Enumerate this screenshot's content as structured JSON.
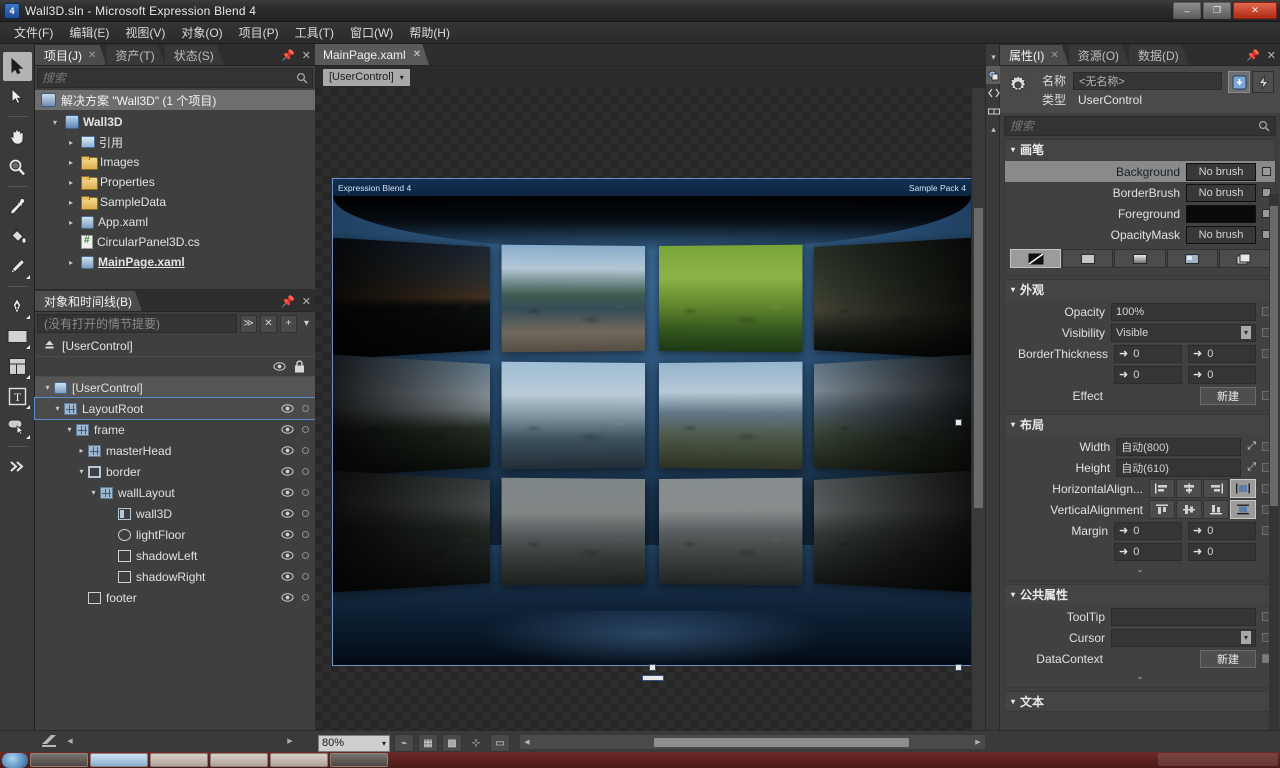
{
  "window": {
    "title": "Wall3D.sln - Microsoft Expression Blend 4",
    "app_icon": "blend-icon",
    "minimize": "–",
    "restore": "❐",
    "close": "✕"
  },
  "menu": {
    "items": [
      {
        "label": "文件(F)"
      },
      {
        "label": "编辑(E)"
      },
      {
        "label": "视图(V)"
      },
      {
        "label": "对象(O)"
      },
      {
        "label": "项目(P)"
      },
      {
        "label": "工具(T)"
      },
      {
        "label": "窗口(W)"
      },
      {
        "label": "帮助(H)"
      }
    ]
  },
  "toolbox": {
    "tools": [
      {
        "name": "selection-tool",
        "selected": true
      },
      {
        "name": "direct-selection-tool",
        "selected": false
      },
      {
        "name": "pan-tool",
        "selected": false
      },
      {
        "name": "zoom-tool",
        "selected": false
      },
      {
        "name": "eyedropper-tool",
        "selected": false
      },
      {
        "name": "paint-bucket-tool",
        "selected": false
      },
      {
        "name": "brush-tool",
        "selected": false
      },
      {
        "name": "pen-tool",
        "selected": false
      },
      {
        "name": "rectangle-tool",
        "selected": false
      },
      {
        "name": "grid-tool",
        "selected": false
      },
      {
        "name": "text-tool",
        "selected": false
      },
      {
        "name": "button-tool",
        "selected": false
      },
      {
        "name": "asset-library-tool",
        "selected": false
      }
    ]
  },
  "project_panel": {
    "tabs": [
      {
        "label": "项目(J)",
        "active": true,
        "closable": true
      },
      {
        "label": "资产(T)",
        "active": false,
        "closable": false
      },
      {
        "label": "状态(S)",
        "active": false,
        "closable": false
      }
    ],
    "pin_icon": "pin-icon",
    "close_icon": "close-icon",
    "search": {
      "placeholder": "搜索",
      "value": "",
      "icon": "search-icon"
    },
    "solution_row": {
      "label": "解决方案 \"Wall3D\" (1 个项目)",
      "icon": "solution-icon"
    },
    "tree": [
      {
        "label": "Wall3D",
        "icon": "project-icon",
        "indent": 0,
        "twisty": "▾",
        "bold": true
      },
      {
        "label": "引用",
        "icon": "references-icon",
        "indent": 1,
        "twisty": "▸",
        "bold": false
      },
      {
        "label": "Images",
        "icon": "folder-icon",
        "indent": 1,
        "twisty": "▸",
        "bold": false
      },
      {
        "label": "Properties",
        "icon": "folder-icon",
        "indent": 1,
        "twisty": "▸",
        "bold": false
      },
      {
        "label": "SampleData",
        "icon": "folder-icon",
        "indent": 1,
        "twisty": "▸",
        "bold": false
      },
      {
        "label": "App.xaml",
        "icon": "xaml-icon",
        "indent": 1,
        "twisty": "▸",
        "bold": false
      },
      {
        "label": "CircularPanel3D.cs",
        "icon": "csharp-icon",
        "indent": 1,
        "twisty": "",
        "bold": false
      },
      {
        "label": "MainPage.xaml",
        "icon": "xaml-icon",
        "indent": 1,
        "twisty": "▸",
        "bold": false,
        "underline": true
      }
    ]
  },
  "objects_panel": {
    "tabs": [
      {
        "label": "对象和时间线(B)",
        "active": true
      }
    ],
    "pin_icon": "pin-icon",
    "close_icon": "close-icon",
    "storyboard": {
      "placeholder": "(没有打开的情节提要)",
      "buttons": [
        {
          "name": "storyboard-list-button",
          "glyph": "≫"
        },
        {
          "name": "storyboard-close-button",
          "glyph": "✕"
        },
        {
          "name": "storyboard-new-button",
          "glyph": "+"
        },
        {
          "name": "storyboard-menu-button",
          "glyph": "▾"
        }
      ]
    },
    "scope_label": "[UserControl]",
    "scope_icon": "scope-up-icon",
    "column_icons": [
      "eye-icon",
      "lock-icon"
    ],
    "tree": [
      {
        "label": "[UserControl]",
        "icon": "usercontrol-icon",
        "indent": 0,
        "twisty": "▾",
        "state": "scope"
      },
      {
        "label": "LayoutRoot",
        "icon": "grid-icon",
        "indent": 1,
        "twisty": "▾",
        "state": "selected"
      },
      {
        "label": "frame",
        "icon": "grid-icon",
        "indent": 2,
        "twisty": "▾",
        "state": ""
      },
      {
        "label": "masterHead",
        "icon": "grid-icon",
        "indent": 3,
        "twisty": "▸",
        "state": ""
      },
      {
        "label": "border",
        "icon": "border-icon",
        "indent": 3,
        "twisty": "▾",
        "state": ""
      },
      {
        "label": "wallLayout",
        "icon": "grid-icon",
        "indent": 4,
        "twisty": "▾",
        "state": ""
      },
      {
        "label": "wall3D",
        "icon": "wall-icon",
        "indent": 5,
        "twisty": "",
        "state": ""
      },
      {
        "label": "lightFloor",
        "icon": "ellipse-icon",
        "indent": 5,
        "twisty": "",
        "state": ""
      },
      {
        "label": "shadowLeft",
        "icon": "rectangle-icon",
        "indent": 5,
        "twisty": "",
        "state": ""
      },
      {
        "label": "shadowRight",
        "icon": "rectangle-icon",
        "indent": 5,
        "twisty": "",
        "state": ""
      },
      {
        "label": "footer",
        "icon": "rectangle-icon",
        "indent": 3,
        "twisty": "",
        "state": ""
      }
    ]
  },
  "document": {
    "tabs": [
      {
        "label": "MainPage.xaml",
        "active": true,
        "close_icon": "close-icon"
      }
    ],
    "breadcrumb": {
      "label": "[UserControl]",
      "chevron": "▾"
    }
  },
  "artboard": {
    "header_left": "Expression Blend 4",
    "header_right": "Sample Pack 4",
    "photos": [
      {
        "row": 0,
        "col": 0,
        "name": "dusk-treeline",
        "class": "ph-dusk"
      },
      {
        "row": 0,
        "col": 1,
        "name": "lake-shore",
        "class": "ph-lake"
      },
      {
        "row": 0,
        "col": 2,
        "name": "mossy-branches",
        "class": "ph-moss"
      },
      {
        "row": 0,
        "col": 3,
        "name": "fallen-log-forest",
        "class": "ph-forest"
      },
      {
        "row": 1,
        "col": 0,
        "name": "mount-rainier",
        "class": "ph-rainier"
      },
      {
        "row": 1,
        "col": 1,
        "name": "misty-valley",
        "class": "ph-valley"
      },
      {
        "row": 1,
        "col": 2,
        "name": "alpine-peaks",
        "class": "ph-peaks"
      },
      {
        "row": 1,
        "col": 3,
        "name": "mountain-ridge",
        "class": "ph-ridge"
      },
      {
        "row": 2,
        "col": 0,
        "name": "foggy-headland",
        "class": "ph-coast1"
      },
      {
        "row": 2,
        "col": 1,
        "name": "driftwood-beach",
        "class": "ph-coast2"
      },
      {
        "row": 2,
        "col": 2,
        "name": "sea-stacks-beach",
        "class": "ph-coast3"
      },
      {
        "row": 2,
        "col": 3,
        "name": "sea-stacks-cliff",
        "class": "ph-coast4"
      }
    ]
  },
  "properties_panel": {
    "tabs": [
      {
        "label": "属性(I)",
        "active": true,
        "closable": true
      },
      {
        "label": "资源(O)",
        "active": false,
        "closable": false
      },
      {
        "label": "数据(D)",
        "active": false,
        "closable": false
      }
    ],
    "pin_icon": "pin-icon",
    "close_icon": "close-icon",
    "name_label": "名称",
    "name_value": "<无名称>",
    "type_label": "类型",
    "type_value": "UserControl",
    "header_buttons": [
      {
        "name": "show-properties-button",
        "active": true
      },
      {
        "name": "show-events-button",
        "active": false
      }
    ],
    "search": {
      "placeholder": "搜索",
      "value": "",
      "icon": "search-icon"
    },
    "sections": {
      "brushes": {
        "title": "画笔",
        "twisty": "▾",
        "rows": [
          {
            "key": "Background",
            "value": "No brush",
            "kind": "brush",
            "selected": true
          },
          {
            "key": "BorderBrush",
            "value": "No brush",
            "kind": "brush",
            "selected": false
          },
          {
            "key": "Foreground",
            "value": "",
            "kind": "swatch",
            "color": "#0a0a0a",
            "selected": false
          },
          {
            "key": "OpacityMask",
            "value": "No brush",
            "kind": "brush",
            "selected": false
          }
        ],
        "editor_tabs": [
          {
            "name": "no-brush-tab",
            "active": true
          },
          {
            "name": "solid-color-brush-tab",
            "active": false
          },
          {
            "name": "gradient-brush-tab",
            "active": false
          },
          {
            "name": "tile-brush-tab",
            "active": false
          },
          {
            "name": "brush-resources-tab",
            "active": false
          }
        ]
      },
      "appearance": {
        "title": "外观",
        "twisty": "▾",
        "opacity_label": "Opacity",
        "opacity_value": "100%",
        "visibility_label": "Visibility",
        "visibility_value": "Visible",
        "border_thickness_label": "BorderThickness",
        "border_thickness": {
          "left": "0",
          "right": "0",
          "top": "0",
          "bottom": "0"
        },
        "effect_label": "Effect",
        "effect_button": "新建"
      },
      "layout": {
        "title": "布局",
        "twisty": "▾",
        "width_label": "Width",
        "width_value": "自动(800)",
        "height_label": "Height",
        "height_value": "自动(610)",
        "halign_label": "HorizontalAlign...",
        "halign_options": [
          "left",
          "center",
          "right",
          "stretch"
        ],
        "halign_selected": 3,
        "valign_label": "VerticalAlignment",
        "valign_options": [
          "top",
          "center",
          "bottom",
          "stretch"
        ],
        "valign_selected": 3,
        "margin_label": "Margin",
        "margin": {
          "left": "0",
          "right": "0",
          "top": "0",
          "bottom": "0"
        },
        "expand_glyph": "⌄"
      },
      "common": {
        "title": "公共属性",
        "twisty": "▾",
        "tooltip_label": "ToolTip",
        "tooltip_value": "",
        "cursor_label": "Cursor",
        "cursor_value": "",
        "datacontext_label": "DataContext",
        "datacontext_button": "新建",
        "expand_glyph": "⌄"
      },
      "text": {
        "title": "文本",
        "twisty": "▾"
      }
    }
  },
  "status_bar": {
    "zoom_value": "80%",
    "zoom_chevron": "▾",
    "buttons": [
      {
        "name": "snap-to-guides-button",
        "glyph": "⌁"
      },
      {
        "name": "show-grid-button",
        "glyph": "▦"
      },
      {
        "name": "snap-to-grid-button",
        "glyph": "▩"
      },
      {
        "name": "snap-to-snaplines-button",
        "glyph": "⊹"
      },
      {
        "name": "annotations-button",
        "glyph": "▭"
      }
    ],
    "left_nav": {
      "back": "◀",
      "forward": "▶"
    }
  },
  "taskbar": {
    "start_label": "",
    "items": [
      {
        "name": "taskbar-item-1"
      },
      {
        "name": "taskbar-item-2"
      },
      {
        "name": "taskbar-item-3"
      },
      {
        "name": "taskbar-item-4"
      },
      {
        "name": "taskbar-item-5"
      },
      {
        "name": "taskbar-item-6"
      }
    ]
  }
}
